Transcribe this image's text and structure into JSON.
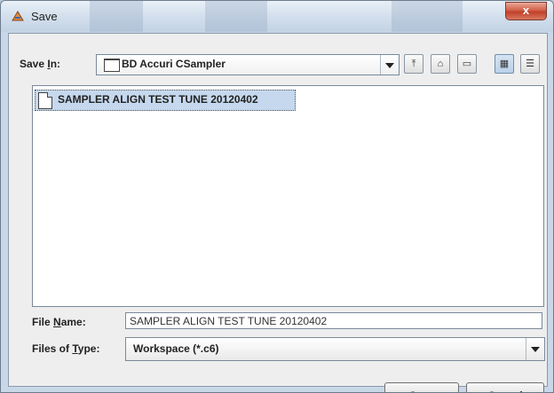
{
  "window": {
    "title": "Save",
    "close_label": "x"
  },
  "save_in": {
    "label_pre": "Save ",
    "label_mnemonic": "I",
    "label_post": "n:",
    "value": "BD Accuri CSampler",
    "icon": "folder-icon"
  },
  "toolbar": [
    {
      "name": "up-folder-button",
      "icon": "up-folder-icon",
      "glyph": "⤒"
    },
    {
      "name": "home-button",
      "icon": "home-icon",
      "glyph": "⌂"
    },
    {
      "name": "new-folder-button",
      "icon": "new-folder-icon",
      "glyph": "▭"
    },
    {
      "name": "list-view-button",
      "icon": "list-view-icon",
      "glyph": "▦"
    },
    {
      "name": "details-view-button",
      "icon": "details-view-icon",
      "glyph": "☰"
    }
  ],
  "files": [
    {
      "name": "SAMPLER ALIGN TEST TUNE 20120402",
      "icon": "document-icon",
      "selected": true
    }
  ],
  "file_name": {
    "label_pre": "File ",
    "label_mnemonic": "N",
    "label_post": "ame:",
    "value": "SAMPLER ALIGN TEST TUNE 20120402"
  },
  "file_type": {
    "label_pre": "Files of ",
    "label_mnemonic": "T",
    "label_post": "ype:",
    "value": "Workspace (*.c6)"
  },
  "buttons": {
    "save": "Save",
    "cancel": "Cancel"
  },
  "colors": {
    "selection": "#c5d8ed",
    "title_gradient_top": "#e9f0f7",
    "close_red": "#c0412a"
  }
}
